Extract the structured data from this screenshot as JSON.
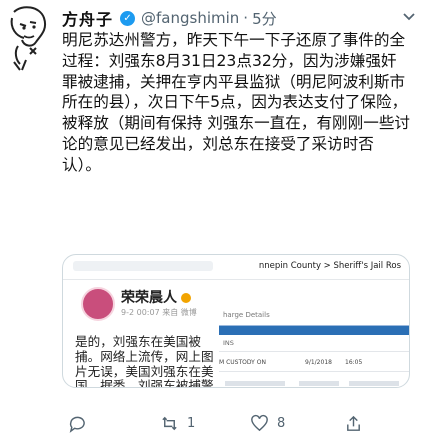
{
  "author": {
    "name": "方舟子",
    "handle": "@fangshimin",
    "time": "5分",
    "verified": true
  },
  "tweet_text": "明尼苏达州警方，昨天下午一下子还原了事件的全过程：刘强东8月31日23点32分，因为涉嫌强奸罪被逮捕，关押在亨内平县监狱（明尼阿波利斯市所在的县），次日下午5点，因为表达支付了保险，被释放（期间有保持 刘强东一直在，有刚刚一些讨论的意见已经发出，刘总东在接受了采访时否认）。",
  "media": {
    "breadcrumb": "nnepin County > Sheriff's Jail Ros",
    "quoted_name": "荣荣晨人",
    "quoted_meta": "9-2 00:07  来自 微博",
    "charge_label": "harge Details",
    "quoted_text": "是的，刘强东在美国被捕。网络上流传，网上图片无误，美国刘强东在美国，据悉，刘强东被捕警方释放后，美国相关法律规定开放的公开资料已在美国官网上可以查看了有关刘强东的相关记录。",
    "ins_label": "INS",
    "custody_label": "M CUSTODY ON",
    "custody_date": "9/1/2018",
    "custody_time": "16:05"
  },
  "actions": {
    "reply_count": "",
    "retweet_count": "1",
    "like_count": "8",
    "share_count": ""
  }
}
